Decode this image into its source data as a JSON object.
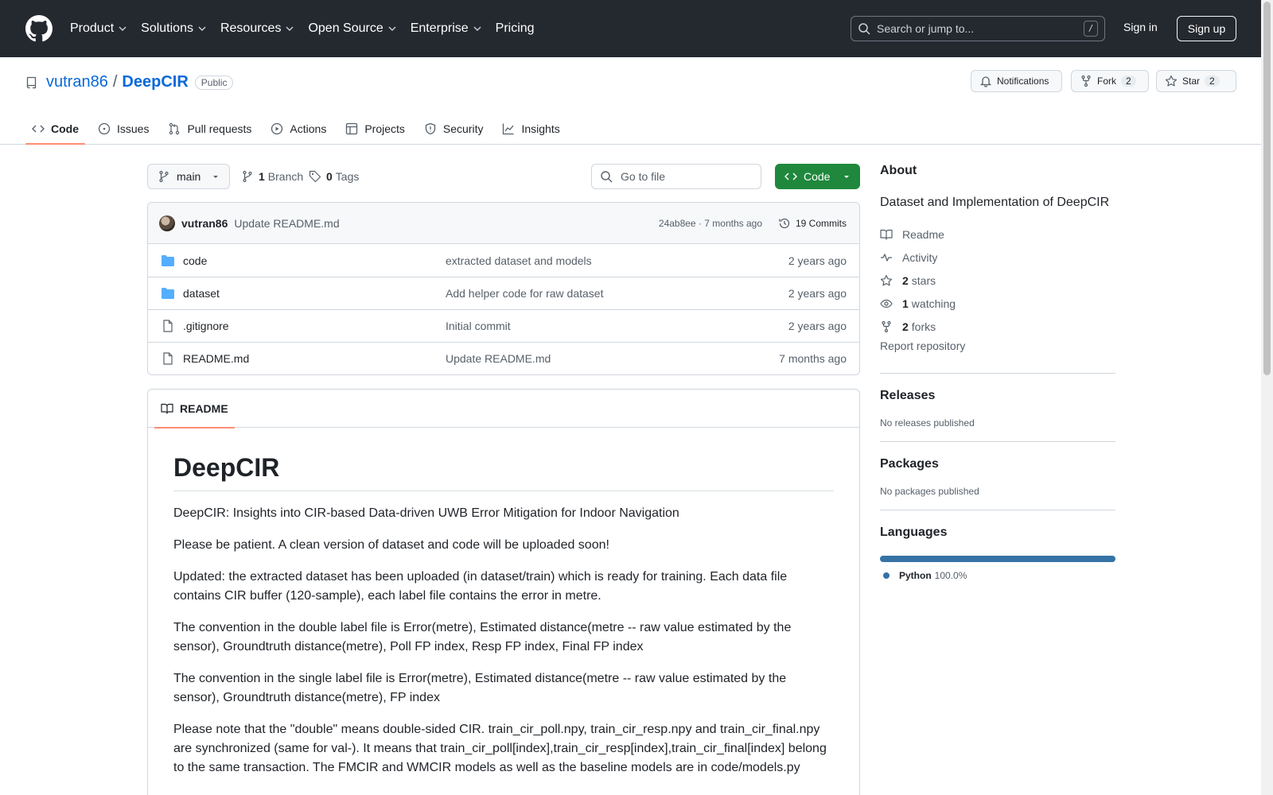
{
  "header": {
    "nav": [
      "Product",
      "Solutions",
      "Resources",
      "Open Source",
      "Enterprise",
      "Pricing"
    ],
    "search_placeholder": "Search or jump to...",
    "search_shortcut": "/",
    "sign_in": "Sign in",
    "sign_up": "Sign up"
  },
  "repo": {
    "owner": "vutran86",
    "separator": "/",
    "name": "DeepCIR",
    "visibility": "Public",
    "notifications_label": "Notifications",
    "fork_label": "Fork",
    "fork_count": "2",
    "star_label": "Star",
    "star_count": "2",
    "tabs": [
      "Code",
      "Issues",
      "Pull requests",
      "Actions",
      "Projects",
      "Security",
      "Insights"
    ]
  },
  "toolbar": {
    "branch": "main",
    "branch_count": "1",
    "branch_label": "Branch",
    "tag_count": "0",
    "tag_label": "Tags",
    "goto_placeholder": "Go to file",
    "code_button": "Code"
  },
  "latest_commit": {
    "author": "vutran86",
    "message": "Update README.md",
    "sha_time": "24ab8ee · 7 months ago",
    "commits": "19 Commits"
  },
  "files": [
    {
      "name": "code",
      "type": "folder",
      "message": "extracted dataset and models",
      "age": "2 years ago"
    },
    {
      "name": "dataset",
      "type": "folder",
      "message": "Add helper code for raw dataset",
      "age": "2 years ago"
    },
    {
      "name": ".gitignore",
      "type": "file",
      "message": "Initial commit",
      "age": "2 years ago"
    },
    {
      "name": "README.md",
      "type": "file",
      "message": "Update README.md",
      "age": "7 months ago"
    }
  ],
  "readme": {
    "tab": "README",
    "title": "DeepCIR",
    "paragraphs": [
      "DeepCIR: Insights into CIR-based Data-driven UWB Error Mitigation for Indoor Navigation",
      "Please be patient. A clean version of dataset and code will be uploaded soon!",
      "Updated: the extracted dataset has been uploaded (in dataset/train) which is ready for training. Each data file contains CIR buffer (120-sample), each label file contains the error in metre.",
      "The convention in the double label file is Error(metre), Estimated distance(metre -- raw value estimated by the sensor), Groundtruth distance(metre), Poll FP index, Resp FP index, Final FP index",
      "The convention in the single label file is Error(metre), Estimated distance(metre -- raw value estimated by the sensor), Groundtruth distance(metre), FP index",
      "Please note that the \"double\" means double-sided CIR. train_cir_poll.npy, train_cir_resp.npy and train_cir_final.npy are synchronized (same for val-). It means that train_cir_poll[index],train_cir_resp[index],train_cir_final[index] belong to the same transaction. The FMCIR and WMCIR models as well as the baseline models are in code/models.py"
    ]
  },
  "sidebar": {
    "about_title": "About",
    "description": "Dataset and Implementation of DeepCIR",
    "readme_label": "Readme",
    "activity_label": "Activity",
    "stars_count": "2",
    "stars_label": "stars",
    "watching_count": "1",
    "watching_label": "watching",
    "forks_count": "2",
    "forks_label": "forks",
    "report": "Report repository",
    "releases_title": "Releases",
    "releases_none": "No releases published",
    "packages_title": "Packages",
    "packages_none": "No packages published",
    "languages_title": "Languages",
    "language": "Python",
    "language_pct": "100.0%",
    "language_color": "#3572A5"
  },
  "colors": {
    "header_bg": "#24292f",
    "link": "#0969da",
    "primary_button": "#1f883d",
    "active_tab_underline": "#fd8c73",
    "folder": "#54aeff"
  }
}
